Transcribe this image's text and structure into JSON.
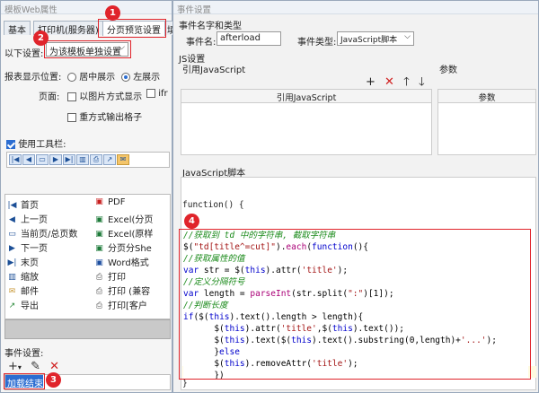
{
  "left_window": {
    "title": "模板Web属性",
    "tabs": [
      "基本",
      "打印机(服务器)",
      "分页预览设置",
      "填"
    ],
    "setting_label": "以下设置:",
    "setting_value": "为该模板单独设置",
    "display_pos_label": "报表显示位置:",
    "pos_center": "居中展示",
    "pos_left": "左展示",
    "page_label": "页面:",
    "image_mode": "以图片方式显示",
    "iframe": "ifr",
    "repeat_grid": "重方式输出格子",
    "toolbar_label": "使用工具栏:",
    "left_items": [
      "首页",
      "上一页",
      "当前页/总页数",
      "下一页",
      "末页",
      "缩放",
      "邮件",
      "导出"
    ],
    "right_items": [
      "PDF",
      "Excel(分页",
      "Excel(原样",
      "分页分She",
      "Word格式",
      "打印",
      "打印 (兼容",
      "打印[客户"
    ],
    "event_label": "事件设置:",
    "event_item": "加载结束"
  },
  "right_window": {
    "title": "事件设置",
    "section_name": "事件名字和类型",
    "event_name_label": "事件名:",
    "event_name_value": "afterload",
    "event_type_label": "事件类型:",
    "event_type_value": "JavaScript脚本",
    "js_settings": "JS设置",
    "ref_js_title": "引用JavaScript",
    "ref_js_col": "引用JavaScript",
    "params_title": "参数",
    "params_col": "参数",
    "script_title": "JavaScript脚本",
    "func_header": "function() {",
    "closing_brace": "}"
  },
  "code_lines": [
    {
      "kind": "com",
      "text": "//获取到 td 中的字符串, 截取字符串"
    },
    {
      "kind": "mix",
      "parts": [
        [
          "plain",
          "$("
        ],
        [
          "str",
          "\"td[title^=cut]\""
        ],
        [
          "plain",
          ")."
        ],
        [
          "fn",
          "each"
        ],
        [
          "plain",
          "("
        ],
        [
          "kw",
          "function"
        ],
        [
          "plain",
          "(){"
        ]
      ]
    },
    {
      "kind": "com",
      "text": "//获取属性的值"
    },
    {
      "kind": "mix",
      "parts": [
        [
          "kw",
          "var "
        ],
        [
          "plain",
          "str = $("
        ],
        [
          "kw",
          "this"
        ],
        [
          "plain",
          ").attr("
        ],
        [
          "str",
          "'title'"
        ],
        [
          "plain",
          ");"
        ]
      ]
    },
    {
      "kind": "com",
      "text": "//定义分隔符号"
    },
    {
      "kind": "mix",
      "parts": [
        [
          "kw",
          "var "
        ],
        [
          "plain",
          "length = "
        ],
        [
          "fn",
          "parseInt"
        ],
        [
          "plain",
          "(str.split("
        ],
        [
          "str",
          "\":\""
        ],
        [
          "plain",
          ")[1]);"
        ]
      ]
    },
    {
      "kind": "com",
      "text": "//判断长度"
    },
    {
      "kind": "mix",
      "parts": [
        [
          "kw",
          "if"
        ],
        [
          "plain",
          "($("
        ],
        [
          "kw",
          "this"
        ],
        [
          "plain",
          ").text().length > length){"
        ]
      ]
    },
    {
      "kind": "mix",
      "parts": [
        [
          "plain",
          "      $("
        ],
        [
          "kw",
          "this"
        ],
        [
          "plain",
          ").attr("
        ],
        [
          "str",
          "'title'"
        ],
        [
          "plain",
          ",$("
        ],
        [
          "kw",
          "this"
        ],
        [
          "plain",
          ").text());"
        ]
      ]
    },
    {
      "kind": "mix",
      "parts": [
        [
          "plain",
          "      $("
        ],
        [
          "kw",
          "this"
        ],
        [
          "plain",
          ").text($("
        ],
        [
          "kw",
          "this"
        ],
        [
          "plain",
          ").text().substring(0,length)+"
        ],
        [
          "str",
          "'...'"
        ],
        [
          "plain",
          ");"
        ]
      ]
    },
    {
      "kind": "mix",
      "parts": [
        [
          "plain",
          "      }"
        ],
        [
          "kw",
          "else"
        ]
      ]
    },
    {
      "kind": "mix",
      "parts": [
        [
          "plain",
          "      $("
        ],
        [
          "kw",
          "this"
        ],
        [
          "plain",
          ").removeAttr("
        ],
        [
          "str",
          "'title'"
        ],
        [
          "plain",
          ");"
        ]
      ]
    },
    {
      "kind": "mix",
      "parts": [
        [
          "plain",
          "      })"
        ]
      ]
    }
  ],
  "badges": [
    "1",
    "2",
    "3",
    "4"
  ],
  "colors": {
    "highlight": "#e0242b",
    "selection": "#2b6dd1",
    "keyword": "#0000cc",
    "comment": "#1a8a1a"
  }
}
